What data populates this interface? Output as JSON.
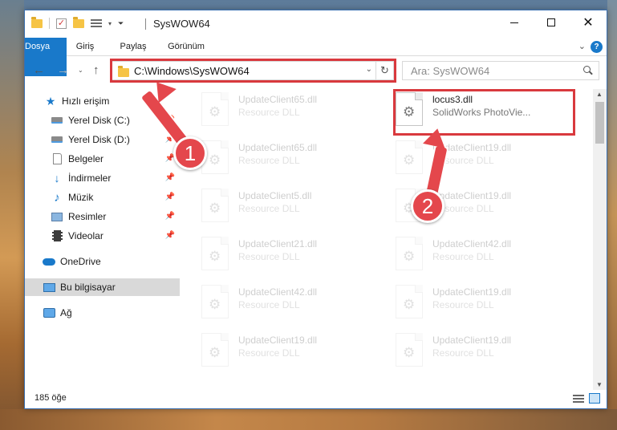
{
  "window": {
    "title": "SysWOW64"
  },
  "ribbon": {
    "tabs": [
      {
        "label": "Dosya"
      },
      {
        "label": "Giriş"
      },
      {
        "label": "Paylaş"
      },
      {
        "label": "Görünüm"
      }
    ],
    "help": "?"
  },
  "nav": {
    "address": "C:\\Windows\\SysWOW64",
    "search_placeholder": "Ara: SysWOW64"
  },
  "sidebar": {
    "items": [
      {
        "label": "Hızlı erişim"
      },
      {
        "label": "Yerel Disk (C:)"
      },
      {
        "label": "Yerel Disk (D:)"
      },
      {
        "label": "Belgeler"
      },
      {
        "label": "İndirmeler"
      },
      {
        "label": "Müzik"
      },
      {
        "label": "Resimler"
      },
      {
        "label": "Videolar"
      },
      {
        "label": "OneDrive"
      },
      {
        "label": "Bu bilgisayar"
      },
      {
        "label": "Ağ"
      }
    ]
  },
  "files": [
    {
      "name": "UpdateClient65.dll",
      "desc": "Resource DLL"
    },
    {
      "name": "locus3.dll",
      "desc": "SolidWorks PhotoVie..."
    },
    {
      "name": "UpdateClient65.dll",
      "desc": "Resource DLL"
    },
    {
      "name": "UpdateClient19.dll",
      "desc": "Resource DLL"
    },
    {
      "name": "UpdateClient5.dll",
      "desc": "Resource DLL"
    },
    {
      "name": "UpdateClient19.dll",
      "desc": "Resource DLL"
    },
    {
      "name": "UpdateClient21.dll",
      "desc": "Resource DLL"
    },
    {
      "name": "UpdateClient42.dll",
      "desc": "Resource DLL"
    },
    {
      "name": "UpdateClient42.dll",
      "desc": "Resource DLL"
    },
    {
      "name": "UpdateClient19.dll",
      "desc": "Resource DLL"
    },
    {
      "name": "UpdateClient19.dll",
      "desc": "Resource DLL"
    },
    {
      "name": "UpdateClient19.dll",
      "desc": "Resource DLL"
    }
  ],
  "status": {
    "count": "185 öğe"
  },
  "annotations": {
    "step1": "1",
    "step2": "2"
  },
  "colors": {
    "accent": "#1979ca",
    "highlight": "#d9393e"
  }
}
